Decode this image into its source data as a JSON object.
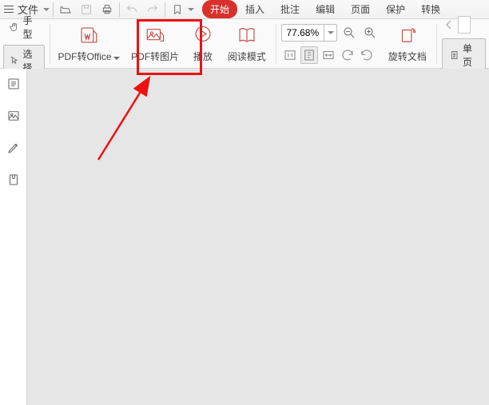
{
  "topbar": {
    "file_label": "文件",
    "tabs": [
      "开始",
      "插入",
      "批注",
      "编辑",
      "页面",
      "保护",
      "转换"
    ],
    "active_tab_index": 0
  },
  "toolbar": {
    "hand_label": "手型",
    "select_label": "选择",
    "pdf_to_office_label": "PDF转Office",
    "pdf_to_image_label": "PDF转图片",
    "play_label": "播放",
    "reading_mode_label": "阅读模式",
    "zoom_value": "77.68%",
    "rotate_doc_label": "旋转文档",
    "single_page_label": "单页"
  },
  "colors": {
    "accent_red": "#d9302c",
    "icon_red": "#c84b47",
    "highlight_red": "#ee1111"
  }
}
